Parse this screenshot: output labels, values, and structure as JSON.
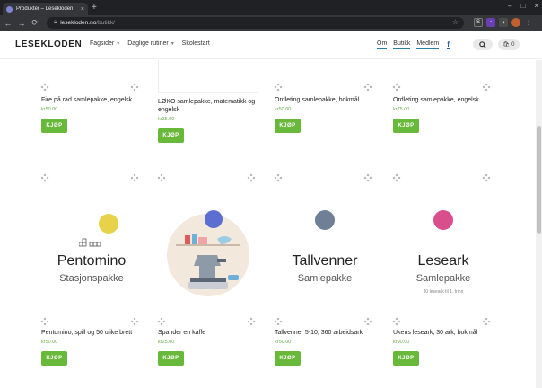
{
  "browser": {
    "tab_title": "Produkter – Lesekloden",
    "tab_close": "×",
    "new_tab": "+",
    "url_host": "lesekloden.no",
    "url_path": "/butikk/",
    "back": "←",
    "forward": "→",
    "reload": "⟳",
    "window_controls": [
      "–",
      "□",
      "×"
    ]
  },
  "site": {
    "logo": "LESEKLODEN",
    "nav": [
      {
        "label": "Fagsider",
        "has_dropdown": true
      },
      {
        "label": "Daglige rutiner",
        "has_dropdown": true
      },
      {
        "label": "Skolestart",
        "has_dropdown": false
      }
    ],
    "right_nav": [
      "Om",
      "Butikk",
      "Medlem"
    ],
    "facebook": "f",
    "cart_count": "0"
  },
  "products_row1": [
    {
      "name": "Fire på rad samlepakke, engelsk",
      "price": "kr50.00",
      "buy": "KJØP"
    },
    {
      "name": "LØKO samlepakke, matematikk og engelsk",
      "price": "kr35.00",
      "buy": "KJØP"
    },
    {
      "name": "Ordleting samlepakke, bokmål",
      "price": "kr50.00",
      "buy": "KJØP"
    },
    {
      "name": "Ordleting samlepakke, engelsk",
      "price": "kr75.00",
      "buy": "KJØP"
    }
  ],
  "products_row2": [
    {
      "name": "Pentomino, spill og 50 ulike brett",
      "price": "kr50.00",
      "buy": "KJØP",
      "title": "Pentomino",
      "subtitle": "Stasjonspakke",
      "globe_color": "#e8d24a"
    },
    {
      "name": "Spander en kaffe",
      "price": "kr25.00",
      "buy": "KJØP",
      "globe_color": "#5b6fd1"
    },
    {
      "name": "Tallvenner 5-10, 360 arbeidsark",
      "price": "kr50.00",
      "buy": "KJØP",
      "title": "Tallvenner",
      "subtitle": "Samlepakke",
      "globe_color": "#6f7f96"
    },
    {
      "name": "Ukens leseark, 30 ark, bokmål",
      "price": "kr90.00",
      "buy": "KJØP",
      "title": "Leseark",
      "subtitle": "Samlepakke",
      "note": "30 leseark til 1. trinn",
      "globe_color": "#d94e8c"
    }
  ]
}
